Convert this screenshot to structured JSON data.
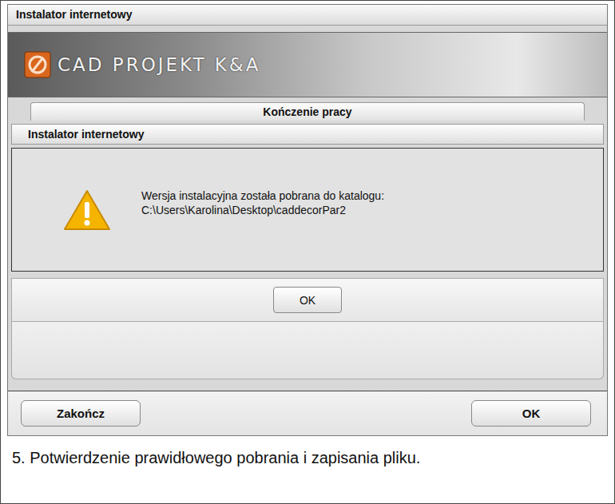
{
  "window": {
    "title": "Instalator internetowy"
  },
  "banner": {
    "logo": "CAD PROJEKT K&A"
  },
  "step_header": "Kończenie pracy",
  "dialog": {
    "title": "Instalator internetowy",
    "message_lines": [
      "Wersja instalacyjna została pobrana do katalogu:",
      "C:\\Users\\Karolina\\Desktop\\caddecorPar2"
    ],
    "buttons": [
      "OK"
    ]
  },
  "footer_buttons": [
    "Zakończ",
    "OK"
  ],
  "caption": "5. Potwierdzenie prawidłowego pobrania i zapisania pliku."
}
